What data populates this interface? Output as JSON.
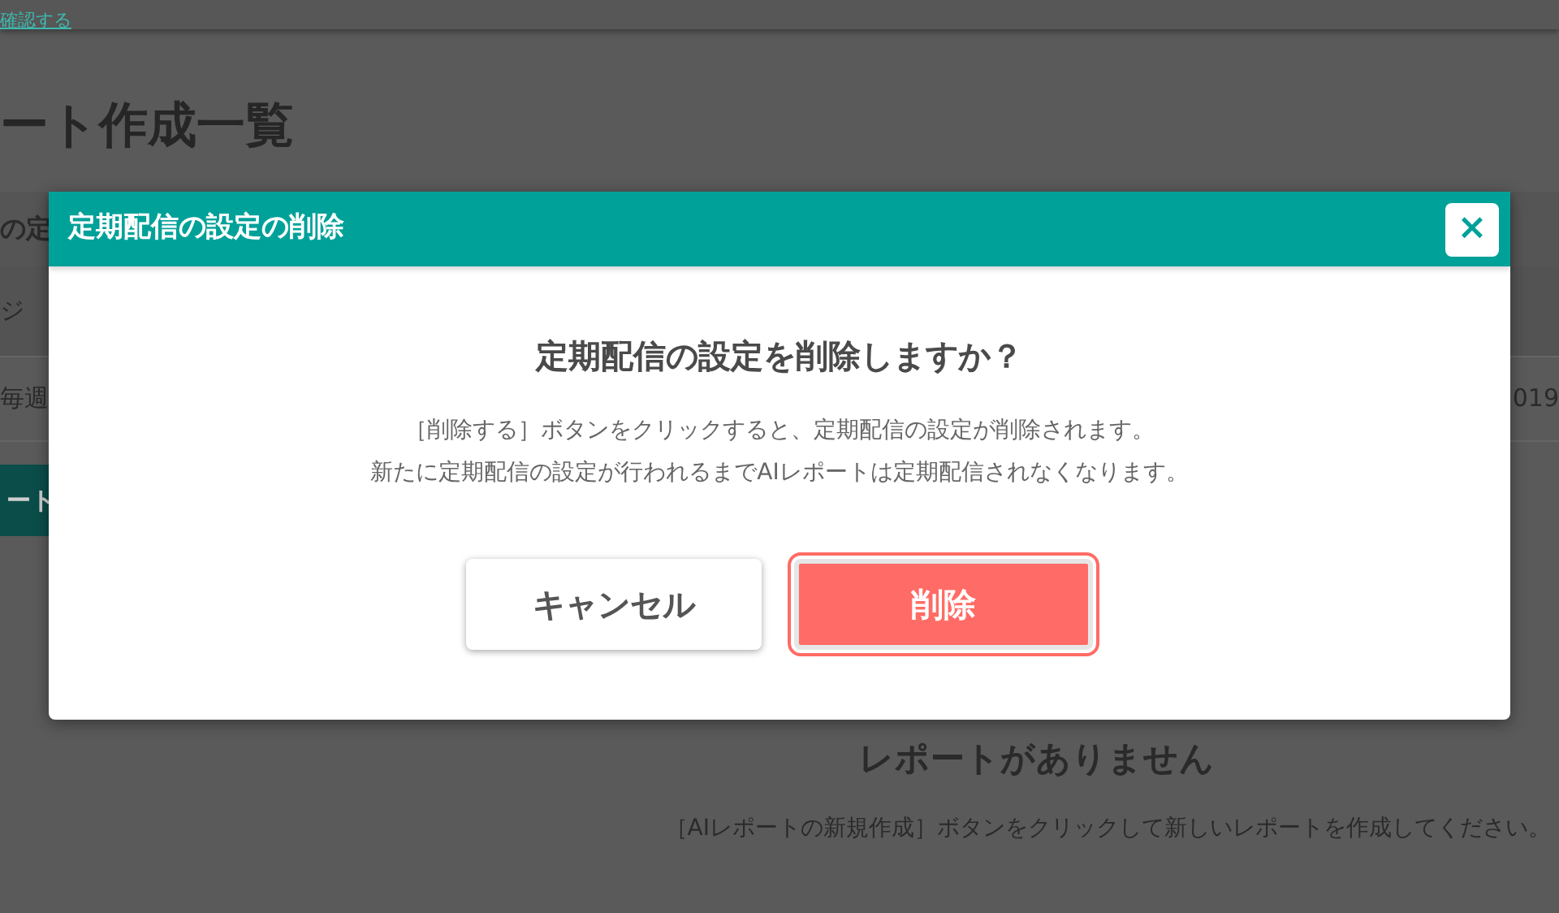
{
  "background": {
    "header_link": "確認する",
    "page_title": "ート作成一覧",
    "section_label": "の定",
    "table_header": "ジ",
    "row_cells": [
      "毎週",
      "019"
    ],
    "create_button": "ート",
    "empty_title": "レポートがありません",
    "empty_message": "［AIレポートの新規作成］ボタンをクリックして新しいレポートを作成してください。"
  },
  "dialog": {
    "title": "定期配信の設定の削除",
    "close": "×",
    "heading": "定期配信の設定を削除しますか？",
    "message": [
      "［削除する］ボタンをクリックすると、定期配信の設定が削除されます。",
      "新たに定期配信の設定が行われるまでAIレポートは定期配信されなくなります。"
    ],
    "buttons": [
      {
        "kind": "secondary",
        "label": "キャンセル",
        "focused": false
      },
      {
        "kind": "danger",
        "label": "削除",
        "focused": true
      }
    ]
  }
}
